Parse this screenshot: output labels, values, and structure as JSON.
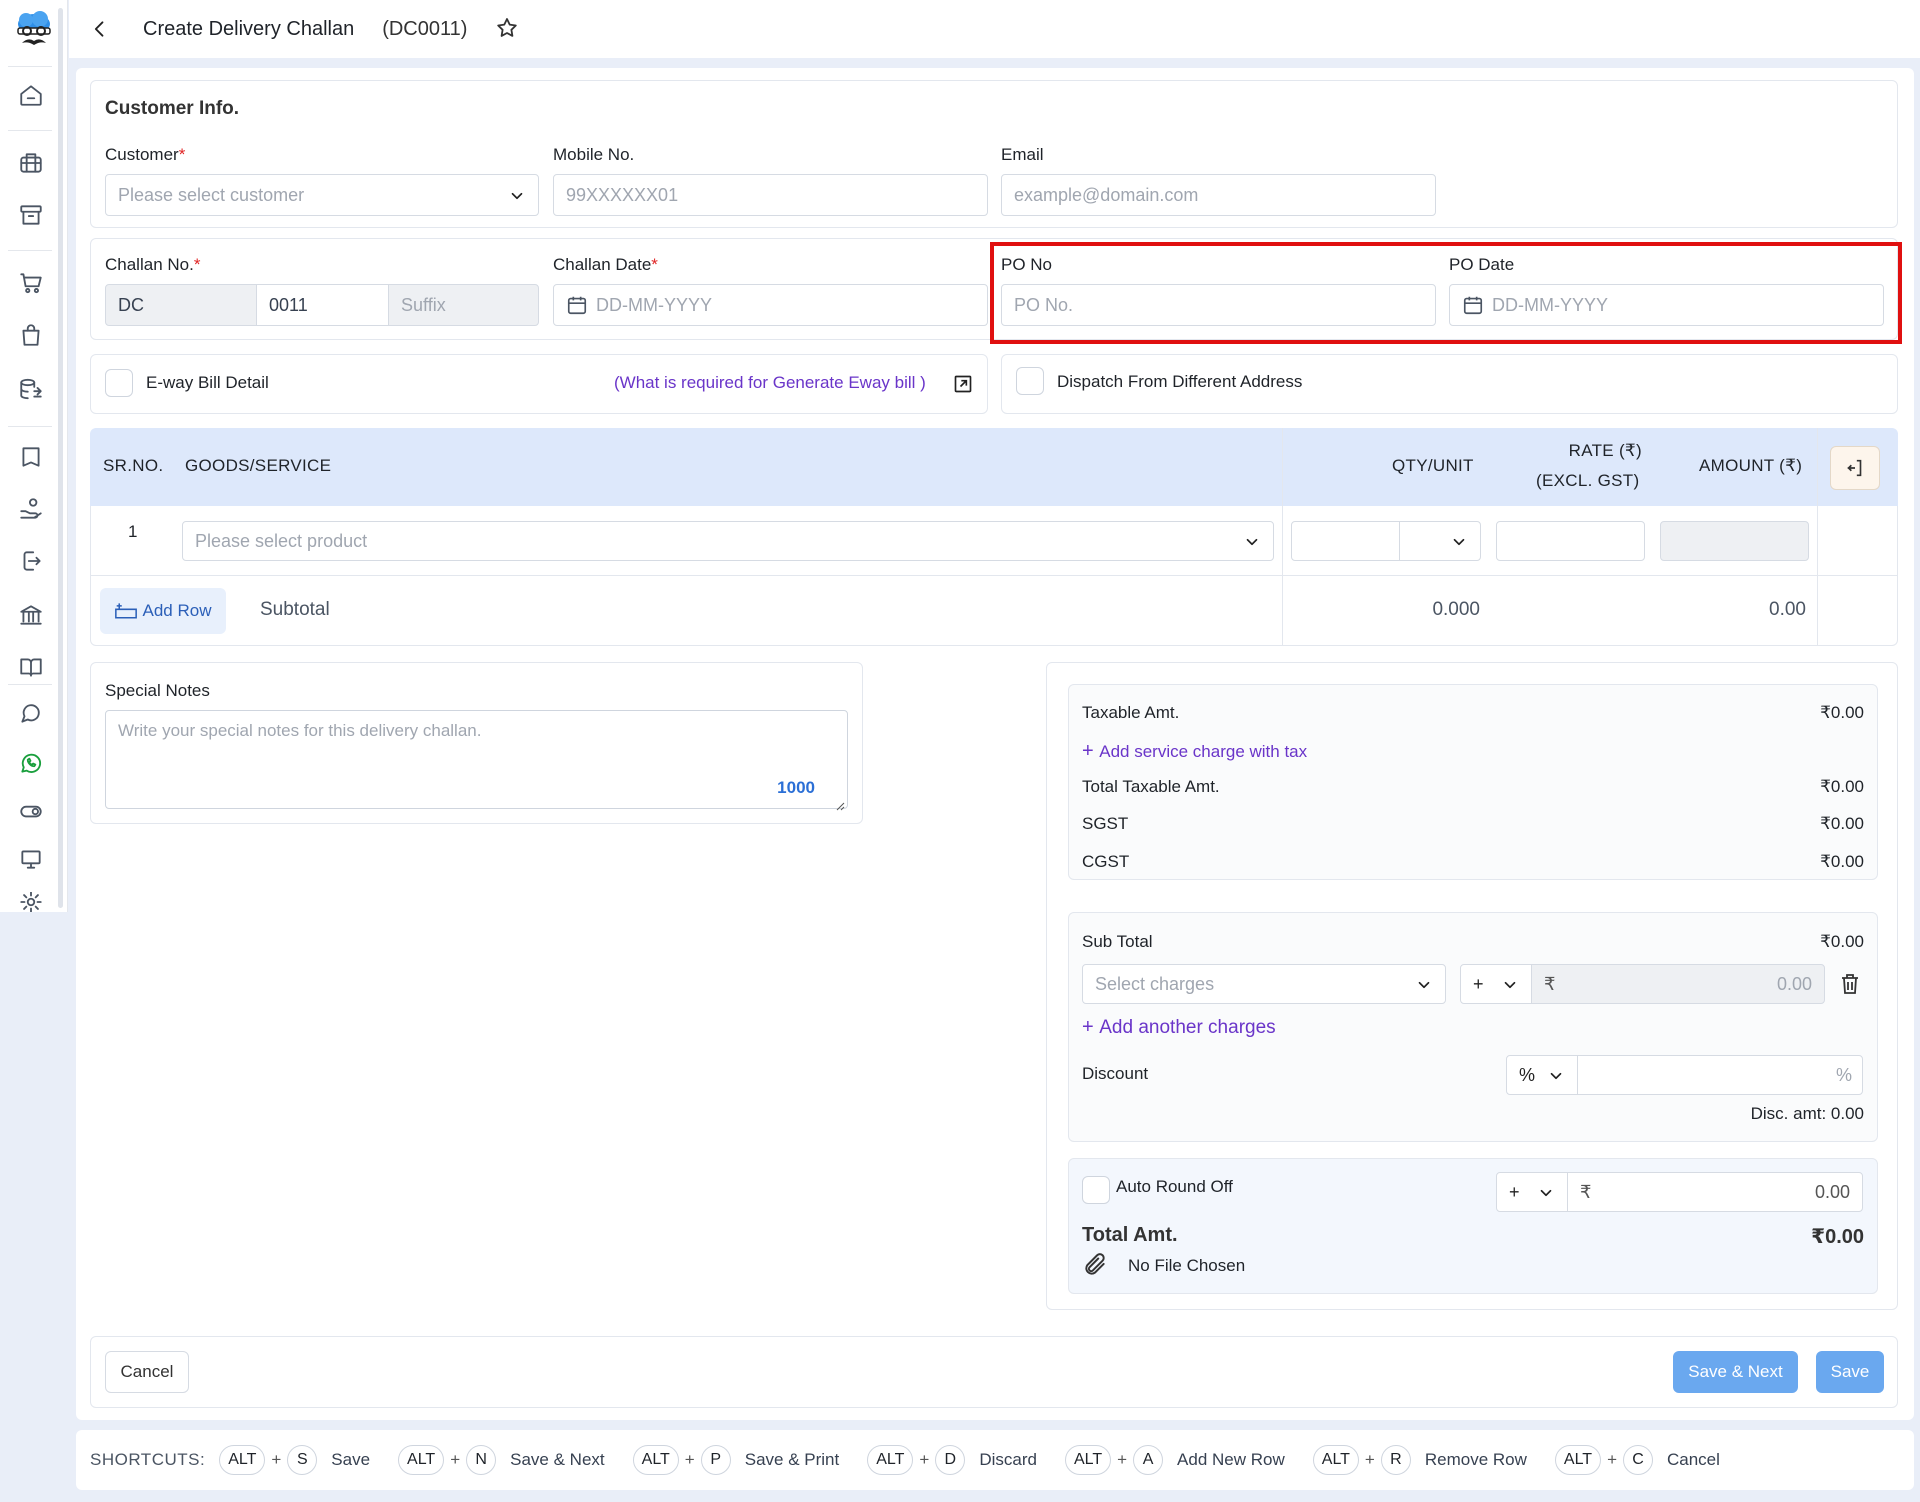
{
  "header": {
    "title": "Create Delivery Challan",
    "code": "(DC0011)"
  },
  "customer_info": {
    "section_title": "Customer Info.",
    "customer_label": "Customer",
    "customer_placeholder": "Please select customer",
    "mobile_label": "Mobile No.",
    "mobile_placeholder": "99XXXXXX01",
    "email_label": "Email",
    "email_placeholder": "example@domain.com"
  },
  "challan": {
    "challan_no_label": "Challan No.",
    "prefix": "DC",
    "number": "0011",
    "suffix_placeholder": "Suffix",
    "date_label": "Challan Date",
    "date_placeholder": "DD-MM-YYYY",
    "po_no_label": "PO No",
    "po_no_placeholder": "PO No.",
    "po_date_label": "PO Date",
    "po_date_placeholder": "DD-MM-YYYY"
  },
  "eway": {
    "label": "E-way Bill Detail",
    "link": "(What is required for Generate Eway bill )",
    "dispatch_label": "Dispatch From Different Address"
  },
  "table": {
    "headers": {
      "sr": "SR.NO.",
      "goods": "GOODS/SERVICE",
      "qty": "QTY/UNIT",
      "rate_1": "RATE (₹)",
      "rate_2": "(EXCL. GST)",
      "amount": "AMOUNT (₹)"
    },
    "row_no": "1",
    "product_placeholder": "Please select product",
    "add_row": "Add Row",
    "subtotal_label": "Subtotal",
    "subtotal_qty": "0.000",
    "subtotal_amount": "0.00"
  },
  "notes": {
    "label": "Special Notes",
    "placeholder": "Write your special notes for this delivery challan.",
    "char_count": "1000"
  },
  "summary": {
    "taxable_label": "Taxable Amt.",
    "taxable_value": "₹0.00",
    "add_service_charge": "Add service charge with tax",
    "total_taxable_label": "Total Taxable Amt.",
    "total_taxable_value": "₹0.00",
    "sgst_label": "SGST",
    "sgst_value": "₹0.00",
    "cgst_label": "CGST",
    "cgst_value": "₹0.00",
    "subtotal_label": "Sub Total",
    "subtotal_value": "₹0.00",
    "charges_placeholder": "Select charges",
    "charge_sign": "+",
    "currency": "₹",
    "charge_amount": "0.00",
    "add_another_charges": "Add another charges",
    "discount_label": "Discount",
    "discount_type": "%",
    "discount_suffix": "%",
    "disc_amt": "Disc. amt: 0.00",
    "round_off_label": "Auto Round Off",
    "round_sign": "+",
    "round_amount": "0.00",
    "total_label": "Total Amt.",
    "total_value": "₹0.00",
    "file_label": "No File Chosen"
  },
  "footer": {
    "cancel": "Cancel",
    "save_next": "Save & Next",
    "save": "Save"
  },
  "shortcuts": {
    "title": "SHORTCUTS:",
    "items": [
      {
        "mod": "ALT",
        "key": "S",
        "label": "Save"
      },
      {
        "mod": "ALT",
        "key": "N",
        "label": "Save & Next"
      },
      {
        "mod": "ALT",
        "key": "P",
        "label": "Save & Print"
      },
      {
        "mod": "ALT",
        "key": "D",
        "label": "Discard"
      },
      {
        "mod": "ALT",
        "key": "A",
        "label": "Add New Row"
      },
      {
        "mod": "ALT",
        "key": "R",
        "label": "Remove Row"
      },
      {
        "mod": "ALT",
        "key": "C",
        "label": "Cancel"
      }
    ]
  },
  "colors": {
    "accent": "#6aa8ef",
    "link": "#6a35c9",
    "highlight": "#e01010",
    "whatsapp": "#1a9f3d"
  }
}
